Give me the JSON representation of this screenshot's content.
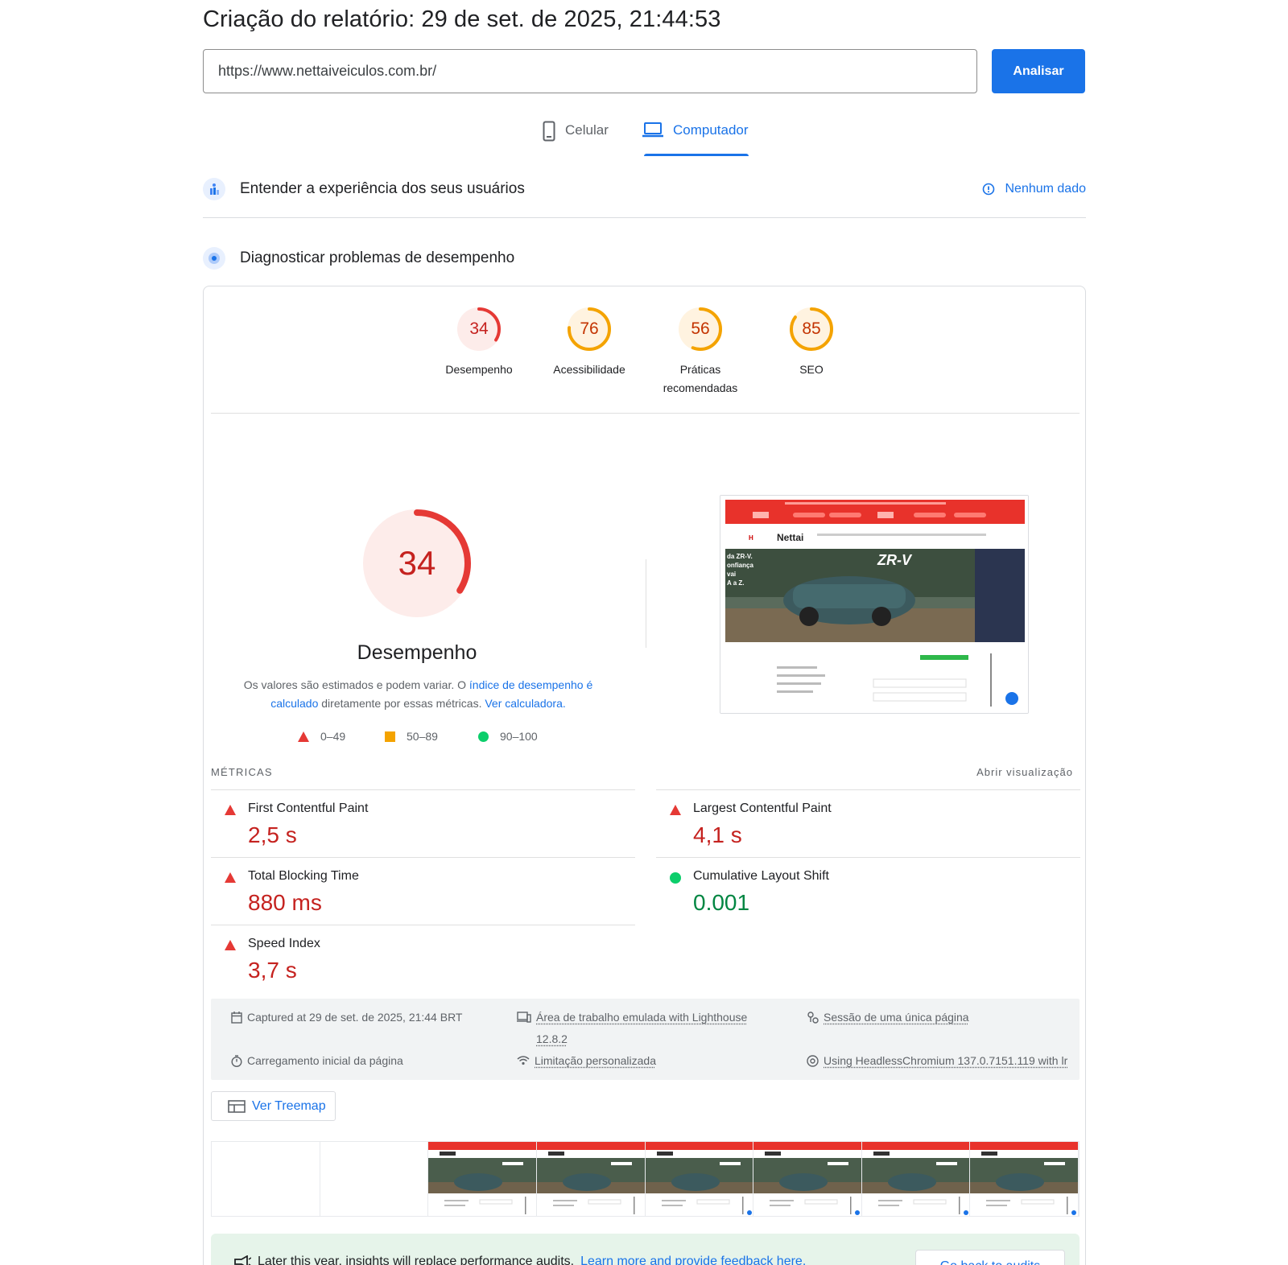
{
  "header": {
    "report_title": "Criação do relatório: 29 de set. de 2025, 21:44:53",
    "url_value": "https://www.nettaiveiculos.com.br/",
    "analyze_label": "Analisar"
  },
  "tabs": [
    {
      "label": "Celular",
      "selected": false,
      "icon": "phone-icon"
    },
    {
      "label": "Computador",
      "selected": true,
      "icon": "laptop-icon"
    }
  ],
  "sections": {
    "experience": {
      "label": "Entender a experiência dos seus usuários",
      "status": "Nenhum dado"
    },
    "diagnose": {
      "label": "Diagnosticar problemas de desempenho"
    }
  },
  "scores": [
    {
      "label": "Desempenho",
      "value": 34,
      "color": "#e53935",
      "bg": "#fdecea"
    },
    {
      "label": "Acessibilidade",
      "value": 76,
      "color": "#f4a300",
      "bg": "#fff3e0"
    },
    {
      "label": "Práticas recomendadas",
      "value": 56,
      "color": "#f4a300",
      "bg": "#fff3e0"
    },
    {
      "label": "SEO",
      "value": 85,
      "color": "#f4a300",
      "bg": "#fff3e0"
    }
  ],
  "performance": {
    "score": 34,
    "title": "Desempenho",
    "desc_prefix": "Os valores são estimados e podem variar. O ",
    "desc_link1": "índice de desempenho é calculado",
    "desc_middle": " diretamente por essas métricas. ",
    "desc_link2": "Ver calculadora."
  },
  "legend": [
    {
      "range": "0–49",
      "shape": "triangle",
      "color": "#e53935"
    },
    {
      "range": "50–89",
      "shape": "square",
      "color": "#f4a300"
    },
    {
      "range": "90–100",
      "shape": "circle",
      "color": "#0cce6b"
    }
  ],
  "screenshot": {
    "brand": "Nettai",
    "model": "ZR-V",
    "hero_text": "da ZR-V. onfiança vai A a Z."
  },
  "metrics": {
    "heading": "MÉTRICAS",
    "toggle": "Abrir visualização",
    "items": [
      {
        "name": "First Contentful Paint",
        "value": "2,5 s",
        "status": "bad"
      },
      {
        "name": "Largest Contentful Paint",
        "value": "4,1 s",
        "status": "bad"
      },
      {
        "name": "Total Blocking Time",
        "value": "880 ms",
        "status": "bad"
      },
      {
        "name": "Cumulative Layout Shift",
        "value": "0.001",
        "status": "good"
      },
      {
        "name": "Speed Index",
        "value": "3,7 s",
        "status": "bad"
      }
    ]
  },
  "runtime": {
    "captured": "Captured at 29 de set. de 2025, 21:44 BRT",
    "device": "Área de trabalho emulada with Lighthouse",
    "device_version": "12.8.2",
    "session": "Sessão de uma única página",
    "load": "Carregamento inicial da página",
    "throttling": "Limitação personalizada",
    "browser": "Using HeadlessChromium 137.0.7151.119 with lr"
  },
  "treemap_label": "Ver Treemap",
  "filmstrip_frames": 8,
  "insight": {
    "text": "Later this year, insights will replace performance audits.",
    "link": "Learn more and provide feedback here.",
    "button": "Go back to audits"
  }
}
